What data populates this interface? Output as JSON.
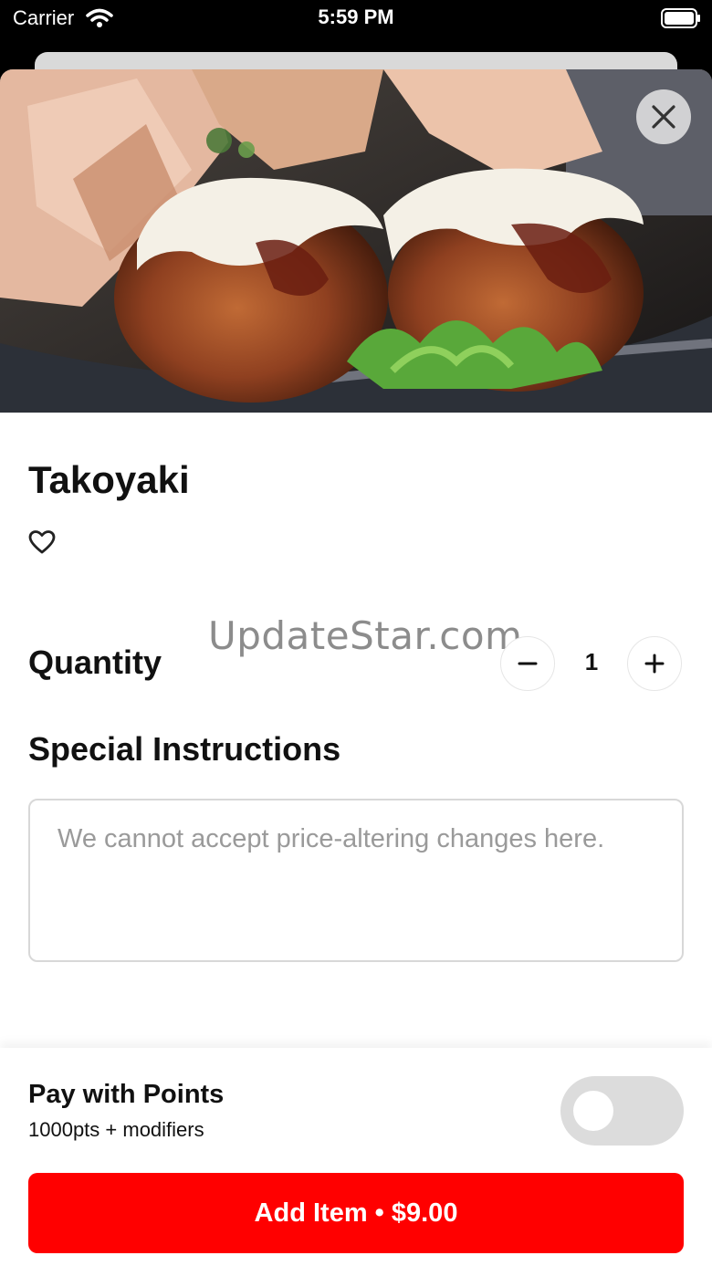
{
  "status_bar": {
    "carrier": "Carrier",
    "time": "5:59 PM"
  },
  "item": {
    "name": "Takoyaki",
    "image_subject": "Takoyaki balls topped with bonito flakes, mayonnaise, sauce and parsley"
  },
  "watermark": "UpdateStar.com",
  "quantity": {
    "label": "Quantity",
    "value": "1"
  },
  "special_instructions": {
    "label": "Special Instructions",
    "placeholder": "We cannot accept price-altering changes here.",
    "value": ""
  },
  "pay_with_points": {
    "label": "Pay with Points",
    "detail": "1000pts + modifiers",
    "enabled": false
  },
  "add_button": {
    "label": "Add Item • $9.00"
  },
  "colors": {
    "accent": "#ff0000",
    "toggle_off": "#dcdcdc"
  },
  "icons": [
    "wifi-icon",
    "battery-icon",
    "close-icon",
    "heart-icon",
    "minus-icon",
    "plus-icon"
  ]
}
